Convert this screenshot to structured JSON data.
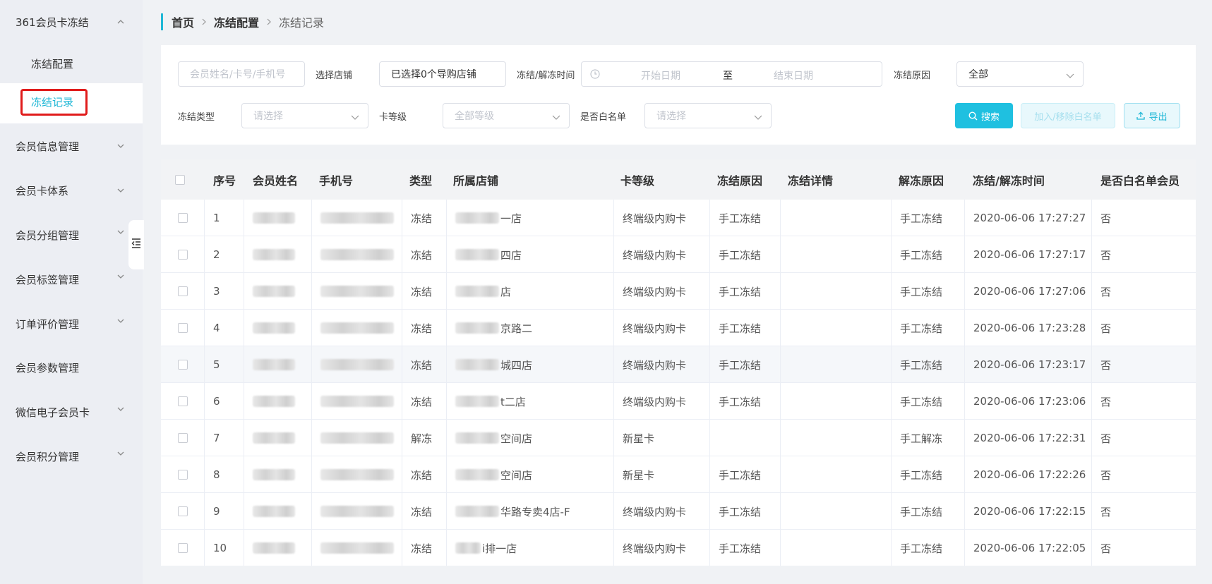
{
  "sidebar": {
    "top_label": "361会员卡冻结",
    "sub_items": [
      "冻结配置",
      "冻结记录"
    ],
    "active_sub": "冻结记录",
    "items": [
      "会员信息管理",
      "会员卡体系",
      "会员分组管理",
      "会员标签管理",
      "订单评价管理",
      "会员参数管理",
      "微信电子会员卡",
      "会员积分管理"
    ]
  },
  "breadcrumb": [
    "首页",
    "冻结配置",
    "冻结记录"
  ],
  "filters": {
    "member_placeholder": "会员姓名/卡号/手机号",
    "store_label": "选择店铺",
    "store_value": "已选择0个导购店铺",
    "time_label": "冻结/解冻时间",
    "date_start": "开始日期",
    "date_sep": "至",
    "date_end": "结束日期",
    "reason_label": "冻结原因",
    "reason_value": "全部",
    "type_label": "冻结类型",
    "type_placeholder": "请选择",
    "level_label": "卡等级",
    "level_placeholder": "全部等级",
    "whitelist_label": "是否白名单",
    "whitelist_placeholder": "请选择"
  },
  "buttons": {
    "search": "搜索",
    "whitelist": "加入/移除白名单",
    "export": "导出"
  },
  "table": {
    "headers": [
      "序号",
      "会员姓名",
      "手机号",
      "类型",
      "所属店铺",
      "卡等级",
      "冻结原因",
      "冻结详情",
      "解冻原因",
      "冻结/解冻时间",
      "是否白名单会员"
    ],
    "rows": [
      {
        "no": "1",
        "type": "冻结",
        "store": "一店",
        "level": "终端级内购卡",
        "reason": "手工冻结",
        "unfreeze": "手工冻结",
        "time": "2020-06-06 17:27:27",
        "white": "否"
      },
      {
        "no": "2",
        "type": "冻结",
        "store": "四店",
        "level": "终端级内购卡",
        "reason": "手工冻结",
        "unfreeze": "手工冻结",
        "time": "2020-06-06 17:27:17",
        "white": "否"
      },
      {
        "no": "3",
        "type": "冻结",
        "store": "店",
        "level": "终端级内购卡",
        "reason": "手工冻结",
        "unfreeze": "手工冻结",
        "time": "2020-06-06 17:27:06",
        "white": "否"
      },
      {
        "no": "4",
        "type": "冻结",
        "store": "京路二",
        "level": "终端级内购卡",
        "reason": "手工冻结",
        "unfreeze": "手工冻结",
        "time": "2020-06-06 17:23:28",
        "white": "否"
      },
      {
        "no": "5",
        "type": "冻结",
        "store": "城四店",
        "level": "终端级内购卡",
        "reason": "手工冻结",
        "unfreeze": "手工冻结",
        "time": "2020-06-06 17:23:17",
        "white": "否"
      },
      {
        "no": "6",
        "type": "冻结",
        "store": "t二店",
        "level": "终端级内购卡",
        "reason": "手工冻结",
        "unfreeze": "手工冻结",
        "time": "2020-06-06 17:23:06",
        "white": "否"
      },
      {
        "no": "7",
        "type": "解冻",
        "store": "空间店",
        "level": "新星卡",
        "reason": "",
        "unfreeze": "手工解冻",
        "time": "2020-06-06 17:22:31",
        "white": "否"
      },
      {
        "no": "8",
        "type": "冻结",
        "store": "空间店",
        "level": "新星卡",
        "reason": "手工冻结",
        "unfreeze": "手工冻结",
        "time": "2020-06-06 17:22:26",
        "white": "否"
      },
      {
        "no": "9",
        "type": "冻结",
        "store": "华路专卖4店-F",
        "level": "终端级内购卡",
        "reason": "手工冻结",
        "unfreeze": "手工冻结",
        "time": "2020-06-06 17:22:15",
        "white": "否"
      },
      {
        "no": "10",
        "type": "冻结",
        "store": "i排一店",
        "level": "终端级内购卡",
        "reason": "手工冻结",
        "unfreeze": "手工冻结",
        "time": "2020-06-06 17:22:05",
        "white": "否"
      }
    ]
  },
  "colors": {
    "accent": "#1fb7d6",
    "highlight": "#e01b1b",
    "sidebar_bg": "#eceef3"
  },
  "icons": [
    "chevron-up-icon",
    "chevron-down-icon",
    "collapse-menu-icon",
    "clock-icon",
    "search-icon",
    "upload-icon"
  ]
}
